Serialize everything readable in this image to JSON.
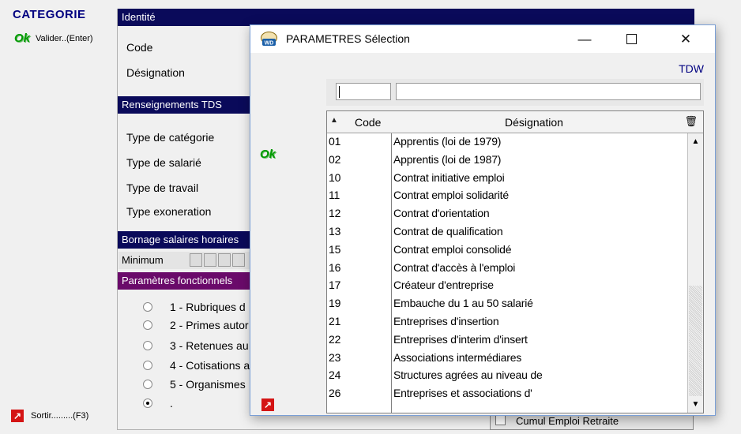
{
  "sidebar": {
    "title": "CATEGORIE",
    "ok_label": "Ok",
    "validate_label": "Valider..(Enter)",
    "exit_label": "Sortir.........(F3)"
  },
  "form": {
    "sections": {
      "identity": "Identité",
      "tds": "Renseignements TDS",
      "bornage": "Bornage salaires horaires",
      "params": "Paramètres fonctionnels"
    },
    "fields": {
      "code": "Code",
      "designation": "Désignation",
      "type_categorie": "Type de catégorie",
      "type_salarie": "Type de salarié",
      "type_travail": "Type de travail",
      "type_exoneration": "Type exoneration",
      "minimum": "Minimum"
    },
    "radio_options": [
      "1 - Rubriques d",
      "2 - Primes autor",
      "3 - Retenues au",
      "4 - Cotisations a",
      "5 - Organismes",
      "."
    ],
    "cumul_label": "Cumul Emploi Retraite"
  },
  "dialog": {
    "title": "PARAMETRES Sélection",
    "tdw": "TDW",
    "ok_label": "Ok",
    "filter_code_value": "",
    "filter_designation_value": "",
    "table": {
      "headers": {
        "code": "Code",
        "designation": "Désignation"
      },
      "rows": [
        {
          "code": "01",
          "designation": "Apprentis (loi de 1979)"
        },
        {
          "code": "02",
          "designation": "Apprentis (loi de 1987)"
        },
        {
          "code": "10",
          "designation": "Contrat initiative emploi"
        },
        {
          "code": "11",
          "designation": "Contrat emploi solidarité"
        },
        {
          "code": "12",
          "designation": "Contrat d'orientation"
        },
        {
          "code": "13",
          "designation": "Contrat de qualification"
        },
        {
          "code": "15",
          "designation": "Contrat emploi consolidé"
        },
        {
          "code": "16",
          "designation": "Contrat d'accès à l'emploi"
        },
        {
          "code": "17",
          "designation": "Créateur d'entreprise"
        },
        {
          "code": "19",
          "designation": "Embauche du  1 au 50   salarié"
        },
        {
          "code": "21",
          "designation": "Entreprises d'insertion"
        },
        {
          "code": "22",
          "designation": "Entreprises d'interim d'insert"
        },
        {
          "code": "23",
          "designation": "Associations intermédiares"
        },
        {
          "code": "24",
          "designation": "Structures agrées au niveau de"
        },
        {
          "code": "26",
          "designation": "Entreprises et associations d'"
        }
      ]
    }
  },
  "colors": {
    "navy_bar": "#0a0a5a",
    "purple_bar": "#6a0a6a",
    "ok_green": "#009a00",
    "exit_red": "#d41414",
    "title_blue": "#000080"
  },
  "icons": {
    "exit": "arrow-exit-icon",
    "app_logo": "windev-logo-icon",
    "sort": "sort-triangle-icon",
    "trash": "trash-icon"
  }
}
